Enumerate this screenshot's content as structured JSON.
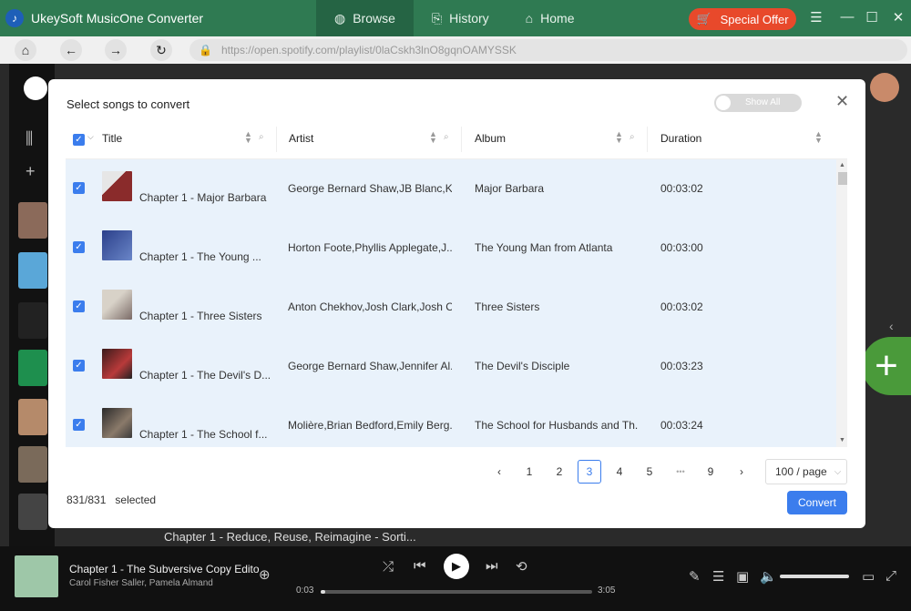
{
  "app": {
    "title": "UkeySoft MusicOne Converter"
  },
  "nav": {
    "tabs": [
      {
        "label": "Browse"
      },
      {
        "label": "History"
      },
      {
        "label": "Home"
      }
    ]
  },
  "offer": {
    "label": "Special Offer"
  },
  "browser": {
    "url": "https://open.spotify.com/playlist/0laCskh3lnO8gqnOAMYSSK"
  },
  "dialog": {
    "title": "Select songs to convert",
    "show_all": "Show All",
    "columns": {
      "title": "Title",
      "artist": "Artist",
      "album": "Album",
      "duration": "Duration"
    },
    "rows": [
      {
        "title": "Chapter 1 - Major Barbara",
        "artist": "George Bernard Shaw,JB Blanc,K...",
        "album": "Major Barbara",
        "duration": "00:03:02"
      },
      {
        "title": "Chapter 1 - The Young ...",
        "artist": "Horton Foote,Phyllis Applegate,J...",
        "album": "The Young Man from Atlanta",
        "duration": "00:03:00"
      },
      {
        "title": "Chapter 1 - Three Sisters",
        "artist": "Anton Chekhov,Josh Clark,Josh C...",
        "album": "Three Sisters",
        "duration": "00:03:02"
      },
      {
        "title": "Chapter 1 - The Devil's D...",
        "artist": "George Bernard Shaw,Jennifer Al...",
        "album": "The Devil's Disciple",
        "duration": "00:03:23"
      },
      {
        "title": "Chapter 1 - The School f...",
        "artist": "Molière,Brian Bedford,Emily Berg...",
        "album": "The School for Husbands and Th...",
        "duration": "00:03:24"
      }
    ],
    "pagination": {
      "pages": [
        "1",
        "2",
        "3",
        "4",
        "5",
        "9"
      ],
      "current": "3",
      "ellipsis": "•••",
      "page_size": "100 / page"
    },
    "selected_count": "831/831",
    "selected_label": "selected",
    "convert_label": "Convert"
  },
  "background": {
    "row_title": "Chapter 1 - Reduce, Reuse, Reimagine - Sorti..."
  },
  "player": {
    "title": "Chapter 1 - The Subversive Copy Edito",
    "artist": "Carol Fisher Saller, Pamela Almand",
    "elapsed": "0:03",
    "total": "3:05",
    "progress": 0.016
  }
}
